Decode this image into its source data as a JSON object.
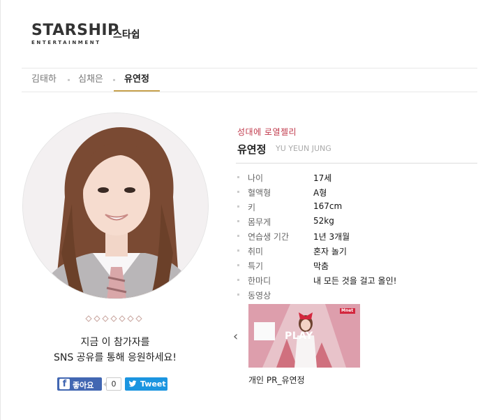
{
  "header": {
    "logo_main": "STARSHIP",
    "logo_sub": "ENTERTAINMENT",
    "agency_name": "스타쉽"
  },
  "tabs": [
    {
      "label": "김태하",
      "active": false
    },
    {
      "label": "심채은",
      "active": false
    },
    {
      "label": "유연정",
      "active": true
    }
  ],
  "profile": {
    "tagline": "성대에 로열젤리",
    "name_ko": "유연정",
    "name_en": "YU YEUN JUNG",
    "info": [
      {
        "key": "나이",
        "value": "17세"
      },
      {
        "key": "혈액형",
        "value": "A형"
      },
      {
        "key": "키",
        "value": "167cm"
      },
      {
        "key": "몸무게",
        "value": "52kg"
      },
      {
        "key": "연습생 기간",
        "value": "1년 3개월"
      },
      {
        "key": "취미",
        "value": "혼자 놀기"
      },
      {
        "key": "특기",
        "value": "막춤"
      },
      {
        "key": "한마디",
        "value": "내 모든 것을 걸고 올인!"
      },
      {
        "key": "동영상",
        "value": ""
      }
    ]
  },
  "video": {
    "play_label": "PLAY",
    "badge": "Mnet",
    "caption": "개인 PR_유연정"
  },
  "cta": {
    "line1": "지금 이 참가자를",
    "line2": "SNS 공유를 통해 응원하세요!"
  },
  "share": {
    "fb_label": "좋아요",
    "fb_count": "0",
    "tw_label": "Tweet"
  },
  "colors": {
    "accent_red": "#c0394b",
    "tab_underline": "#c8a24f",
    "facebook": "#4267b2",
    "twitter": "#1b95e0"
  }
}
